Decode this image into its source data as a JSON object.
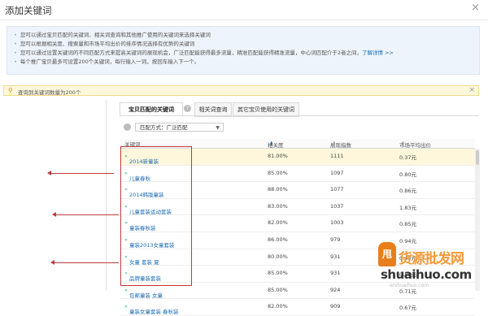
{
  "dialog": {
    "title": "添加关键词",
    "close": "×"
  },
  "tips": [
    "您可以通过宝贝匹配的关键词、相关词查询和其他推广使用的关键词来选择关键词",
    "您可以根据相关度、搜索量和市场平均出价的排序情况选择有优势的关键词",
    "您可以通过设置关键词的不同匹配方式来提高关键词的展现机会，广泛匹配能获得最多流量，精准匹配能获得精准流量，中心词匹配介于2者之间，",
    "每个推广宝贝最多可设置200个关键词，每行输入一词，按回车输入下一个。"
  ],
  "tips_link": "了解详情 >>",
  "warning": {
    "text": "查询到关键词数量为200个",
    "close": "×"
  },
  "tabs": [
    {
      "label": "宝贝匹配的关键词"
    },
    {
      "label": "相关词查询"
    },
    {
      "label": "其它宝贝使用的关键词"
    }
  ],
  "match_type": {
    "label": "匹配方式：",
    "value": "广泛匹配"
  },
  "columns": {
    "keyword": "关键词",
    "relevance": "相关度",
    "impressions": "展现指数",
    "price": "市场平均出价"
  },
  "rows": [
    {
      "keyword": "2014新童装",
      "relevance": "81.00%",
      "impressions": "1111",
      "price": "0.37元"
    },
    {
      "keyword": "儿童春秋",
      "relevance": "85.00%",
      "impressions": "1097",
      "price": "0.80元"
    },
    {
      "keyword": "2014韩版童装",
      "relevance": "88.00%",
      "impressions": "1077",
      "price": "0.86元"
    },
    {
      "keyword": "儿童套装运动套装",
      "relevance": "83.00%",
      "impressions": "1037",
      "price": "1.83元"
    },
    {
      "keyword": "童装春秋装",
      "relevance": "82.00%",
      "impressions": "1003",
      "price": "0.85元"
    },
    {
      "keyword": "童装2013女童套装",
      "relevance": "86.00%",
      "impressions": "979",
      "price": "0.94元"
    },
    {
      "keyword": "女童 套装 夏",
      "relevance": "80.00%",
      "impressions": "931",
      "price": "0.43元"
    },
    {
      "keyword": "品牌童装套装",
      "relevance": "85.00%",
      "impressions": "931",
      "price": "0.85元"
    },
    {
      "keyword": "包邮童装 女童",
      "relevance": "85.00%",
      "impressions": "924",
      "price": "0.71元"
    },
    {
      "keyword": "童装女童套装 春秋装",
      "relevance": "82.00%",
      "impressions": "909",
      "price": "0.67元"
    }
  ],
  "row_prefix": "«",
  "watermark": {
    "mark": "甩",
    "line1": "货源批发网",
    "line2": "shuaihuo.com",
    "line3": "ershuaihuo.com"
  },
  "colors": {
    "accent": "#1a6bb5",
    "annotation": "#c0393b",
    "highlight_row": "#fff7dc",
    "tips_bg": "#eef4fb",
    "warning_bg": "#fdf8dc"
  }
}
